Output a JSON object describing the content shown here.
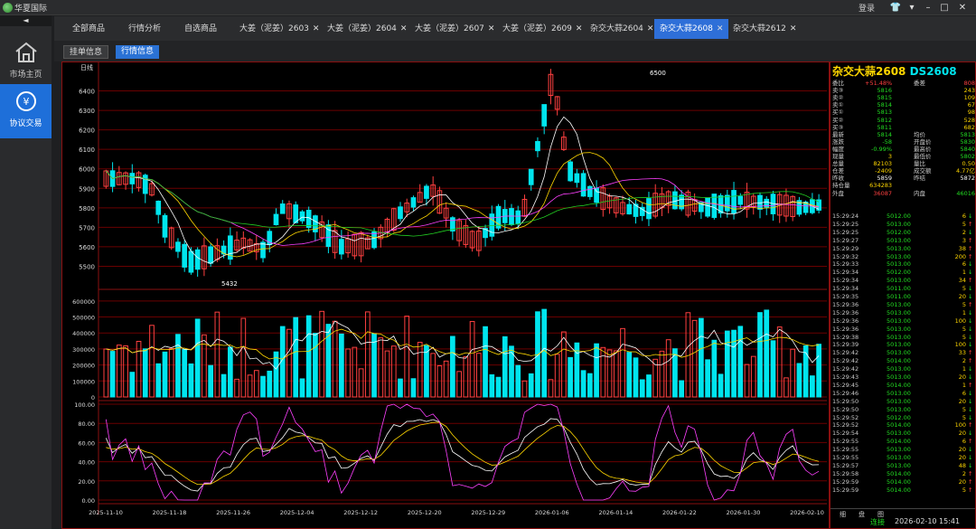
{
  "app": {
    "name": "华夏国际",
    "login": "登录"
  },
  "sidebar": {
    "collapse": "◄",
    "items": [
      {
        "label": "市场主页",
        "icon": "home-icon"
      },
      {
        "label": "协议交易",
        "icon": "yen-exchange-icon"
      }
    ]
  },
  "tabs": [
    {
      "label": "全部商品",
      "close": false,
      "active": false
    },
    {
      "label": "行情分析",
      "close": false,
      "active": false
    },
    {
      "label": "自选商品",
      "close": false,
      "active": false
    },
    {
      "label": "大姜（泥姜）2603",
      "close": true,
      "active": false
    },
    {
      "label": "大姜（泥姜）2604",
      "close": true,
      "active": false
    },
    {
      "label": "大姜（泥姜）2607",
      "close": true,
      "active": false
    },
    {
      "label": "大姜（泥姜）2609",
      "close": true,
      "active": false
    },
    {
      "label": "杂交大蒜2604",
      "close": true,
      "active": false
    },
    {
      "label": "杂交大蒜2608",
      "close": true,
      "active": true
    },
    {
      "label": "杂交大蒜2612",
      "close": true,
      "active": false
    }
  ],
  "subtabs": [
    {
      "label": "挂单信息",
      "style": "btn1"
    },
    {
      "label": "行情信息",
      "style": "btn2"
    },
    {
      "label": "",
      "style": "red"
    },
    {
      "label": "",
      "style": "red"
    },
    {
      "label": "",
      "style": "red"
    },
    {
      "label": "",
      "style": "red"
    }
  ],
  "chart_data": {
    "type": "candlestick",
    "period_label": "日线",
    "price": {
      "ylim": [
        5400,
        6500
      ],
      "yticks": [
        5500,
        5600,
        5700,
        5800,
        5900,
        6000,
        6100,
        6200,
        6300,
        6400
      ],
      "high_label": "6500",
      "low_label": "5432"
    },
    "volume": {
      "ylim": [
        0,
        650000
      ],
      "yticks": [
        0,
        100000,
        200000,
        300000,
        400000,
        500000,
        600000
      ]
    },
    "oscillator": {
      "ylim": [
        0,
        100
      ],
      "yticks": [
        "0.00",
        "20.00",
        "40.00",
        "60.00",
        "80.00",
        "100.00"
      ]
    },
    "dates": [
      "2025-11-10",
      "2025-11-18",
      "2025-11-26",
      "2025-12-04",
      "2025-12-12",
      "2025-12-20",
      "2025-12-29",
      "2026-01-06",
      "2026-01-14",
      "2026-01-22",
      "2026-01-30",
      "2026-02-10"
    ],
    "colors": {
      "up": "#ff4040",
      "down": "#00e5ee",
      "ma1": "#ffffff",
      "ma2": "#ffd700",
      "ma3": "#ff40ff",
      "ma4": "#22cc22",
      "grid": "#6a0000"
    }
  },
  "quote": {
    "name": "杂交大蒜2608",
    "code": "DS2608",
    "rows": [
      {
        "l": "委比",
        "v": "+51.48%",
        "v_color": "#ff4040",
        "l2": "委差",
        "v2": "808",
        "v2_color": "#ff4040"
      },
      {
        "l": "卖③",
        "v": "5816",
        "v_color": "#22dd22",
        "l2": "",
        "v2": "243",
        "v2_color": "#ffd700"
      },
      {
        "l": "卖②",
        "v": "5815",
        "v_color": "#22dd22",
        "l2": "",
        "v2": "109",
        "v2_color": "#ffd700"
      },
      {
        "l": "卖①",
        "v": "5814",
        "v_color": "#22dd22",
        "l2": "",
        "v2": "67",
        "v2_color": "#ffd700"
      },
      {
        "l": "买①",
        "v": "5813",
        "v_color": "#22dd22",
        "l2": "",
        "v2": "98",
        "v2_color": "#ffd700"
      },
      {
        "l": "买②",
        "v": "5812",
        "v_color": "#22dd22",
        "l2": "",
        "v2": "528",
        "v2_color": "#ffd700"
      },
      {
        "l": "买③",
        "v": "5811",
        "v_color": "#22dd22",
        "l2": "",
        "v2": "682",
        "v2_color": "#ffd700"
      },
      {
        "l": "最新",
        "v": "5814",
        "v_color": "#22dd22",
        "l2": "均价",
        "v2": "5813",
        "v2_color": "#22dd22"
      },
      {
        "l": "涨跌",
        "v": "-58",
        "v_color": "#22dd22",
        "l2": "开盘价",
        "v2": "5830",
        "v2_color": "#22dd22"
      },
      {
        "l": "幅度",
        "v": "-0.99%",
        "v_color": "#22dd22",
        "l2": "最高价",
        "v2": "5840",
        "v2_color": "#22dd22"
      },
      {
        "l": "现量",
        "v": "3",
        "v_color": "#ffd700",
        "l2": "最低价",
        "v2": "5802",
        "v2_color": "#22dd22"
      },
      {
        "l": "总量",
        "v": "82103",
        "v_color": "#ffd700",
        "l2": "量比",
        "v2": "0.50",
        "v2_color": "#ffd700"
      },
      {
        "l": "仓差",
        "v": "-2409",
        "v_color": "#ffd700",
        "l2": "成交额",
        "v2": "4.77亿",
        "v2_color": "#ffd700"
      },
      {
        "l": "昨收",
        "v": "5859",
        "v_color": "#ffffff",
        "l2": "昨结",
        "v2": "5872",
        "v2_color": "#ffffff"
      },
      {
        "l": "持仓量",
        "v": "634283",
        "v_color": "#ffd700",
        "l2": "",
        "v2": "",
        "v2_color": "#ffd700"
      },
      {
        "l": "外盘",
        "v": "36087",
        "v_color": "#ff4040",
        "l2": "内盘",
        "v2": "46016",
        "v2_color": "#22dd22"
      }
    ],
    "ticks": [
      {
        "t": "15:29:24",
        "p": "5012.00",
        "v": "6",
        "d": "↓"
      },
      {
        "t": "15:29:25",
        "p": "5013.00",
        "v": "5",
        "d": "↑"
      },
      {
        "t": "15:29:25",
        "p": "5012.00",
        "v": "2",
        "d": "↓"
      },
      {
        "t": "15:29:27",
        "p": "5013.00",
        "v": "3",
        "d": "↑"
      },
      {
        "t": "15:29:29",
        "p": "5013.00",
        "v": "38",
        "d": "↑"
      },
      {
        "t": "15:29:32",
        "p": "5013.00",
        "v": "200",
        "d": "↑"
      },
      {
        "t": "15:29:33",
        "p": "5013.00",
        "v": "6",
        "d": "↓"
      },
      {
        "t": "15:29:34",
        "p": "5012.00",
        "v": "1",
        "d": "↓"
      },
      {
        "t": "15:29:34",
        "p": "5013.00",
        "v": "34",
        "d": "↑"
      },
      {
        "t": "15:29:34",
        "p": "5011.00",
        "v": "5",
        "d": "↓"
      },
      {
        "t": "15:29:35",
        "p": "5011.00",
        "v": "20",
        "d": "↓"
      },
      {
        "t": "15:29:36",
        "p": "5013.00",
        "v": "5",
        "d": "↑"
      },
      {
        "t": "15:29:36",
        "p": "5013.00",
        "v": "1",
        "d": "↓"
      },
      {
        "t": "15:29:36",
        "p": "5013.00",
        "v": "100",
        "d": "↓"
      },
      {
        "t": "15:29:36",
        "p": "5013.00",
        "v": "5",
        "d": "↓"
      },
      {
        "t": "15:29:38",
        "p": "5013.00",
        "v": "5",
        "d": "↓"
      },
      {
        "t": "15:29:39",
        "p": "5013.00",
        "v": "100",
        "d": "↓"
      },
      {
        "t": "15:29:42",
        "p": "5013.00",
        "v": "33",
        "d": "↑"
      },
      {
        "t": "15:29:42",
        "p": "5014.00",
        "v": "2",
        "d": "↑"
      },
      {
        "t": "15:29:42",
        "p": "5013.00",
        "v": "1",
        "d": "↓"
      },
      {
        "t": "15:29:43",
        "p": "5013.00",
        "v": "20",
        "d": "↓"
      },
      {
        "t": "15:29:45",
        "p": "5014.00",
        "v": "1",
        "d": "↑"
      },
      {
        "t": "15:29:46",
        "p": "5013.00",
        "v": "6",
        "d": "↓"
      },
      {
        "t": "15:29:50",
        "p": "5013.00",
        "v": "20",
        "d": "↓"
      },
      {
        "t": "15:29:50",
        "p": "5013.00",
        "v": "5",
        "d": "↓"
      },
      {
        "t": "15:29:52",
        "p": "5012.00",
        "v": "5",
        "d": "↓"
      },
      {
        "t": "15:29:52",
        "p": "5014.00",
        "v": "100",
        "d": "↑"
      },
      {
        "t": "15:29:54",
        "p": "5013.00",
        "v": "20",
        "d": "↓"
      },
      {
        "t": "15:29:55",
        "p": "5014.00",
        "v": "6",
        "d": "↑"
      },
      {
        "t": "15:29:55",
        "p": "5013.00",
        "v": "20",
        "d": "↓"
      },
      {
        "t": "15:29:55",
        "p": "5013.00",
        "v": "20",
        "d": "↓"
      },
      {
        "t": "15:29:57",
        "p": "5013.00",
        "v": "48",
        "d": "↓"
      },
      {
        "t": "15:29:58",
        "p": "5014.00",
        "v": "2",
        "d": "↑"
      },
      {
        "t": "15:29:59",
        "p": "5014.00",
        "v": "20",
        "d": "↑"
      },
      {
        "t": "15:29:59",
        "p": "5014.00",
        "v": "5",
        "d": "↑"
      }
    ],
    "bottom_tabs": [
      "细",
      "盘",
      "图"
    ]
  },
  "status": {
    "conn": "连接",
    "datetime": "2026-02-10 15:41"
  }
}
